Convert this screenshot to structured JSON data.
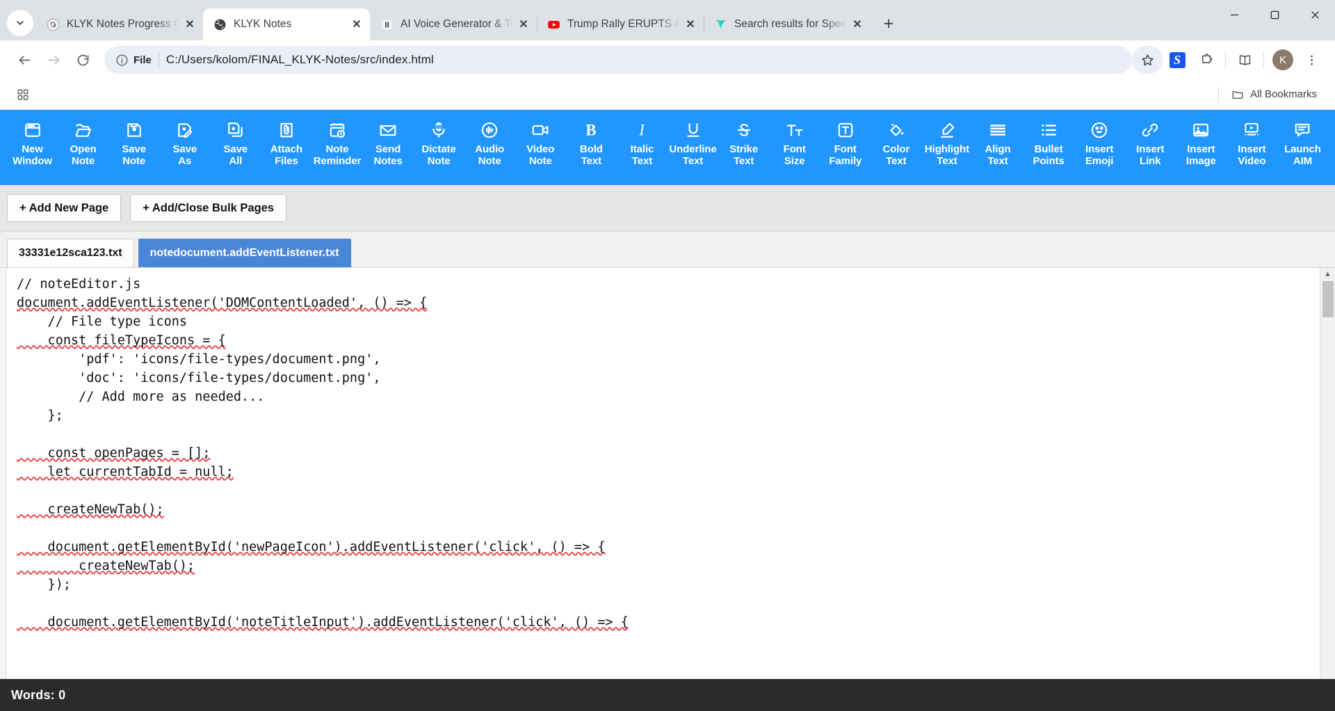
{
  "browser": {
    "tabs": [
      {
        "title": "KLYK Notes Progress Overvie",
        "favicon": "openai-icon",
        "active": false
      },
      {
        "title": "KLYK Notes",
        "favicon": "globe-icon",
        "active": true
      },
      {
        "title": "AI Voice Generator & Text to",
        "favicon": "pause-icon",
        "active": false
      },
      {
        "title": "Trump Rally ERUPTS As Trum",
        "favicon": "youtube-icon",
        "active": false
      },
      {
        "title": "Search results for Speech - F",
        "favicon": "vector-icon",
        "active": false
      }
    ],
    "tab_close_label": "✕",
    "new_tab_label": "+",
    "window_controls": {
      "minimize": "minimize-icon",
      "maximize": "maximize-icon",
      "close": "close-icon"
    },
    "nav": {
      "back": "back-arrow-icon",
      "forward": "forward-arrow-icon",
      "reload": "reload-icon"
    },
    "omnibox": {
      "badge_label": "File",
      "url": "C:/Users/kolom/FINAL_KLYK-Notes/src/index.html"
    },
    "extensions": {
      "grammarly_label": "S",
      "avatar_label": "K"
    },
    "bookmarks": {
      "all_bookmarks_label": "All Bookmarks"
    }
  },
  "app": {
    "toolbar": [
      {
        "icon": "new-window-icon",
        "label": "New\nWindow"
      },
      {
        "icon": "open-folder-icon",
        "label": "Open\nNote"
      },
      {
        "icon": "save-disk-icon",
        "label": "Save\nNote"
      },
      {
        "icon": "save-as-icon",
        "label": "Save\nAs"
      },
      {
        "icon": "save-all-icon",
        "label": "Save\nAll"
      },
      {
        "icon": "attach-files-icon",
        "label": "Attach\nFiles"
      },
      {
        "icon": "calendar-clock-icon",
        "label": "Note\nReminder"
      },
      {
        "icon": "envelope-icon",
        "label": "Send\nNotes"
      },
      {
        "icon": "microphone-icon",
        "label": "Dictate\nNote"
      },
      {
        "icon": "audio-wave-icon",
        "label": "Audio\nNote"
      },
      {
        "icon": "video-camera-icon",
        "label": "Video\nNote"
      },
      {
        "icon": "bold-icon",
        "label": "Bold\nText"
      },
      {
        "icon": "italic-icon",
        "label": "Italic\nText"
      },
      {
        "icon": "underline-icon",
        "label": "Underline\nText"
      },
      {
        "icon": "strikethrough-icon",
        "label": "Strike\nText"
      },
      {
        "icon": "font-size-icon",
        "label": "Font\nSize"
      },
      {
        "icon": "font-family-icon",
        "label": "Font\nFamily"
      },
      {
        "icon": "color-fill-icon",
        "label": "Color\nText"
      },
      {
        "icon": "highlighter-icon",
        "label": "Highlight\nText"
      },
      {
        "icon": "align-text-icon",
        "label": "Align\nText"
      },
      {
        "icon": "bullet-list-icon",
        "label": "Bullet\nPoints"
      },
      {
        "icon": "emoji-smile-icon",
        "label": "Insert\nEmoji"
      },
      {
        "icon": "link-icon",
        "label": "Insert\nLink"
      },
      {
        "icon": "image-icon",
        "label": "Insert\nImage"
      },
      {
        "icon": "video-player-icon",
        "label": "Insert\nVideo"
      },
      {
        "icon": "chat-bubble-icon",
        "label": "Launch\nAIM"
      }
    ],
    "page_buttons": [
      {
        "label": "+ Add New Page"
      },
      {
        "label": "+ Add/Close Bulk Pages"
      }
    ],
    "file_tabs": [
      {
        "label": "33331e12sca123.txt",
        "active": false
      },
      {
        "label": "notedocument.addEventListener.txt",
        "active": true
      }
    ],
    "editor": {
      "lines": [
        "// noteEditor.js",
        "document.addEventListener('DOMContentLoaded', () => {",
        "    // File type icons",
        "    const fileTypeIcons = {",
        "        'pdf': 'icons/file-types/document.png',",
        "        'doc': 'icons/file-types/document.png',",
        "        // Add more as needed...",
        "    };",
        "",
        "    const openPages = [];",
        "    let currentTabId = null;",
        "",
        "    createNewTab();",
        "",
        "    document.getElementById('newPageIcon').addEventListener('click', () => {",
        "        createNewTab();",
        "    });",
        "",
        "    document.getElementById('noteTitleInput').addEventListener('click', () => {"
      ]
    },
    "statusbar": {
      "words_label": "Words: 0"
    },
    "colors": {
      "toolbar_blue": "#2196ff",
      "active_tab_blue": "#4a86d8",
      "statusbar_dark": "#2b2b2b"
    }
  }
}
